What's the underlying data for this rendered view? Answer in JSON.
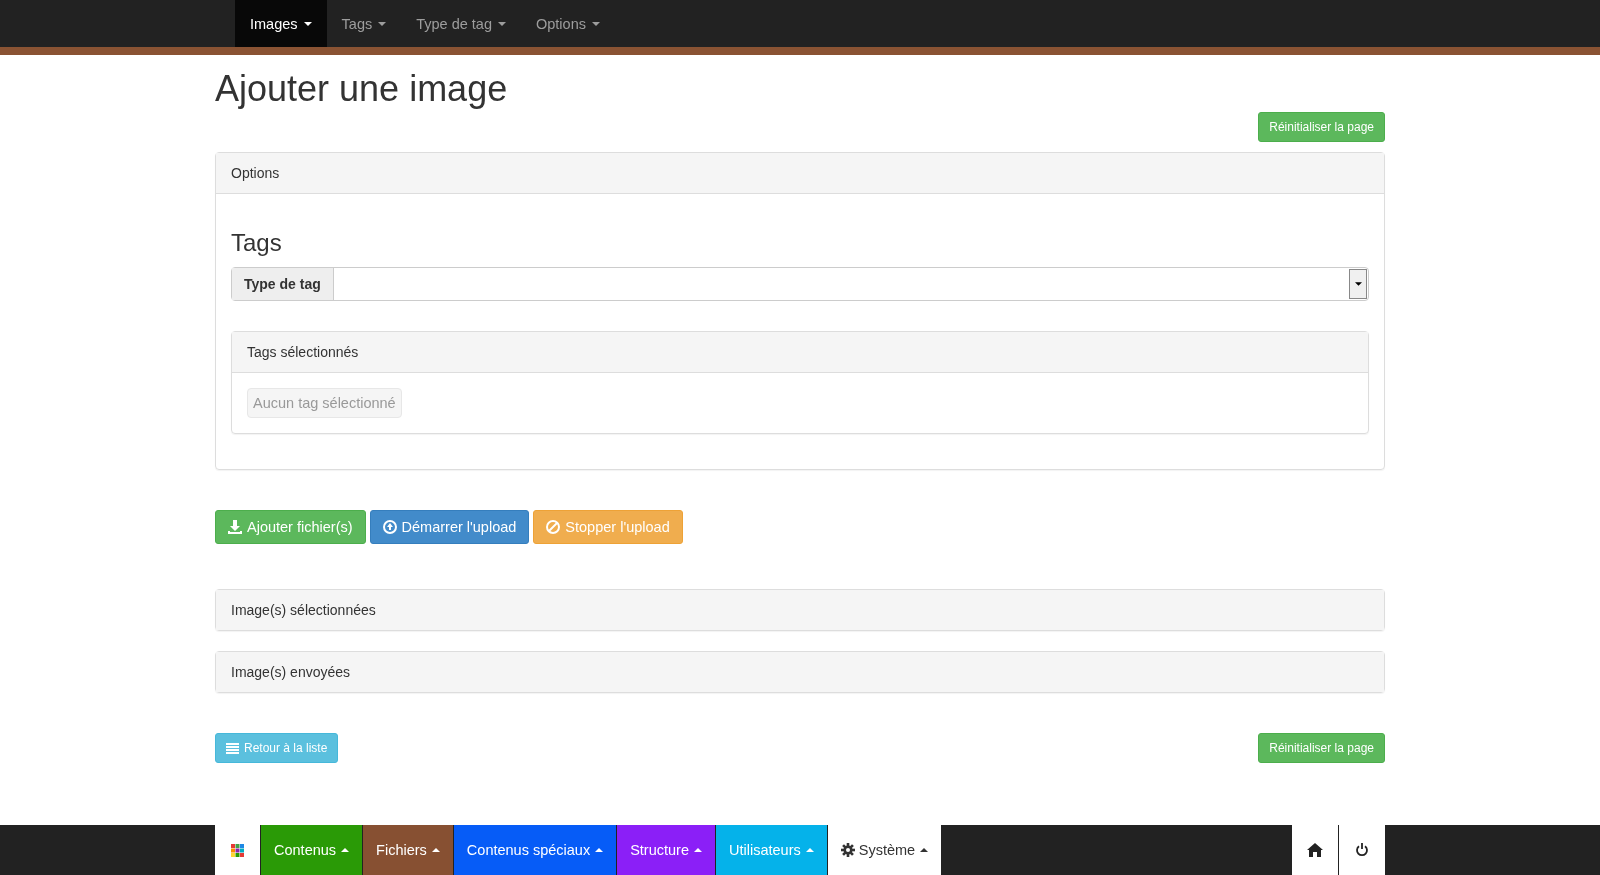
{
  "top_nav": {
    "items": [
      {
        "label": "Images",
        "selected": true
      },
      {
        "label": "Tags",
        "selected": false
      },
      {
        "label": "Type de tag",
        "selected": false
      },
      {
        "label": "Options",
        "selected": false
      }
    ]
  },
  "page_title": "Ajouter une image",
  "reset_button_top": "Réinitialiser la page",
  "options_panel": {
    "heading": "Options",
    "section_title": "Tags",
    "tag_type_label": "Type de tag",
    "selected_tags": {
      "heading": "Tags sélectionnés",
      "empty_label": "Aucun tag sélectionné"
    }
  },
  "upload_buttons": [
    {
      "label": "Ajouter fichier(s)",
      "kind": "add"
    },
    {
      "label": "Démarrer l'upload",
      "kind": "start"
    },
    {
      "label": "Stopper l'upload",
      "kind": "stop"
    }
  ],
  "panels": [
    "Image(s) sélectionnées",
    "Image(s) envoyées"
  ],
  "back_button": "Retour à la liste",
  "reset_button_bottom": "Réinitialiser la page",
  "bottom_bar": {
    "items": [
      {
        "kind": "grid",
        "color": "#ffffff"
      },
      {
        "kind": "menu",
        "label": "Contenus",
        "color": "#2a9a06"
      },
      {
        "kind": "menu",
        "label": "Fichiers",
        "color": "#875032"
      },
      {
        "kind": "menu",
        "label": "Contenus spéciaux",
        "color": "#065cf7"
      },
      {
        "kind": "menu",
        "label": "Structure",
        "color": "#8b1ff7"
      },
      {
        "kind": "menu",
        "label": "Utilisateurs",
        "color": "#05b2ea"
      },
      {
        "kind": "gear",
        "label": "Système",
        "color": "#ffffff"
      }
    ],
    "right_icons": [
      {
        "kind": "home"
      },
      {
        "kind": "power"
      }
    ]
  }
}
